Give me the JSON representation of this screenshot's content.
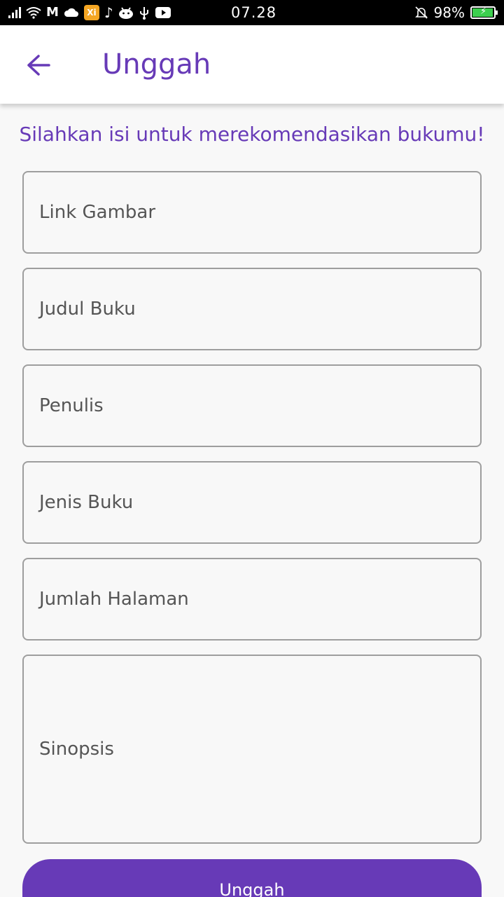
{
  "status_bar": {
    "time": "07.28",
    "battery": "98%",
    "icons": [
      "signal-icon",
      "wifi-icon",
      "gmail-icon",
      "cloud-icon",
      "app-icon",
      "tiktok-icon",
      "android-icon",
      "usb-icon",
      "youtube-icon",
      "mute-bell-icon",
      "battery-icon"
    ]
  },
  "appbar": {
    "title": "Unggah",
    "back_icon": "arrow-left-icon"
  },
  "form": {
    "subtitle": "Silahkan isi untuk merekomendasikan bukumu!",
    "fields": {
      "link_gambar": "Link Gambar",
      "judul_buku": "Judul Buku",
      "penulis": "Penulis",
      "jenis_buku": "Jenis Buku",
      "jumlah_halaman": "Jumlah Halaman",
      "sinopsis": "Sinopsis"
    },
    "submit_label": "Unggah"
  },
  "colors": {
    "accent": "#673ab7",
    "field_border": "#9e9e9e",
    "background": "#f8f8f8"
  }
}
